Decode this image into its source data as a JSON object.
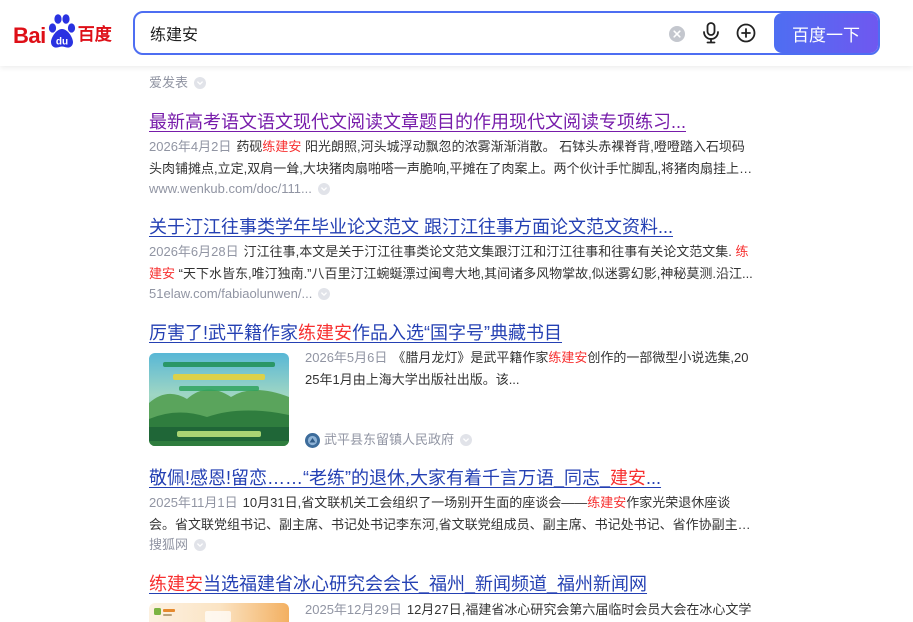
{
  "header": {
    "logo": {
      "part1": "Bai",
      "paw_text": "du",
      "part2": "百度",
      "icon": "paw-icon"
    },
    "search": {
      "value": "练建安",
      "button_label": "百度一下"
    },
    "icons": {
      "clear": "clear-icon",
      "voice": "microphone-icon",
      "more": "add-circle-icon"
    }
  },
  "result_icons": {
    "more": "more-options-icon",
    "site": "site-avatar-icon"
  },
  "colors": {
    "brand_red": "#de0f17",
    "brand_blue": "#2932e1",
    "link": "#2440b3",
    "visited": "#771caa",
    "highlight": "#f73131",
    "button": "#4e6ef2",
    "button_end": "#6f58f0",
    "muted": "#9195a3"
  },
  "results": [
    {
      "source": "爱发表"
    },
    {
      "visited": true,
      "title": {
        "text": "最新高考语文语文现代文阅读文章题目的作用现代文阅读专项练习..."
      },
      "date": "2026年4月2日",
      "desc": {
        "before": "药砚",
        "highlight": "练建安",
        "after": " 阳光朗照,河头城浮动飘忽的浓雾渐渐消散。 石钵头赤裸脊背,噔噔踏入石坝码头肉铺摊点,立定,双肩一耸,大块猪肉扇啪嗒一声脆响,平摊在了肉案上。两个伙计手忙脚乱,将猪肉扇挂上一..."
      },
      "source": "www.wenkub.com/doc/111..."
    },
    {
      "title": {
        "text": "关于汀江往事类学年毕业论文范文 跟汀江往事方面论文范文资料..."
      },
      "date": "2026年6月28日",
      "desc": {
        "before": "汀江往事,本文是关于汀江往事类论文范文集跟汀江和汀江往事和往事有关论文范文集. ",
        "highlight": "练建安",
        "after": " “天下水皆东,唯汀独南.”八百里汀江蜿蜒漂过闽粤大地,其间诸多风物掌故,似迷雾幻影,神秘莫测.沿江..."
      },
      "source": "51elaw.com/fabiaolunwen/..."
    },
    {
      "title": {
        "before": "厉害了!武平籍作家",
        "highlight": "练建安",
        "after": "作品入选“国字号”典藏书目"
      },
      "date": "2026年5月6日",
      "desc": {
        "before": "《腊月龙灯》是武平籍作家",
        "highlight": "练建安",
        "after": "创作的一部微型小说选集,2025年1月由上海大学出版社出版。该..."
      },
      "source": "武平县东留镇人民政府"
    },
    {
      "title": {
        "before": "敬佩!感恩!留恋……“老练”的退休,大家有着千言万语_同志_",
        "highlight": "建安",
        "after": "..."
      },
      "date": "2025年11月1日",
      "desc": {
        "before": "10月31日,省文联机关工会组织了一场别开生面的座谈会——",
        "highlight": "练建安",
        "after": "作家光荣退休座谈会。省文联党组书记、副主席、书记处书记李东河,省文联党组成员、副主席、书记处书记、省作协副主席林..."
      },
      "source": "搜狐网"
    },
    {
      "title": {
        "highlight": "练建安",
        "after": "当选福建省冰心研究会会长_福州_新闻频道_福州新闻网"
      },
      "date": "2025年12月29日",
      "desc": {
        "text": "12月27日,福建省冰心研究会第六届临时会员大会在冰心文学"
      }
    }
  ]
}
